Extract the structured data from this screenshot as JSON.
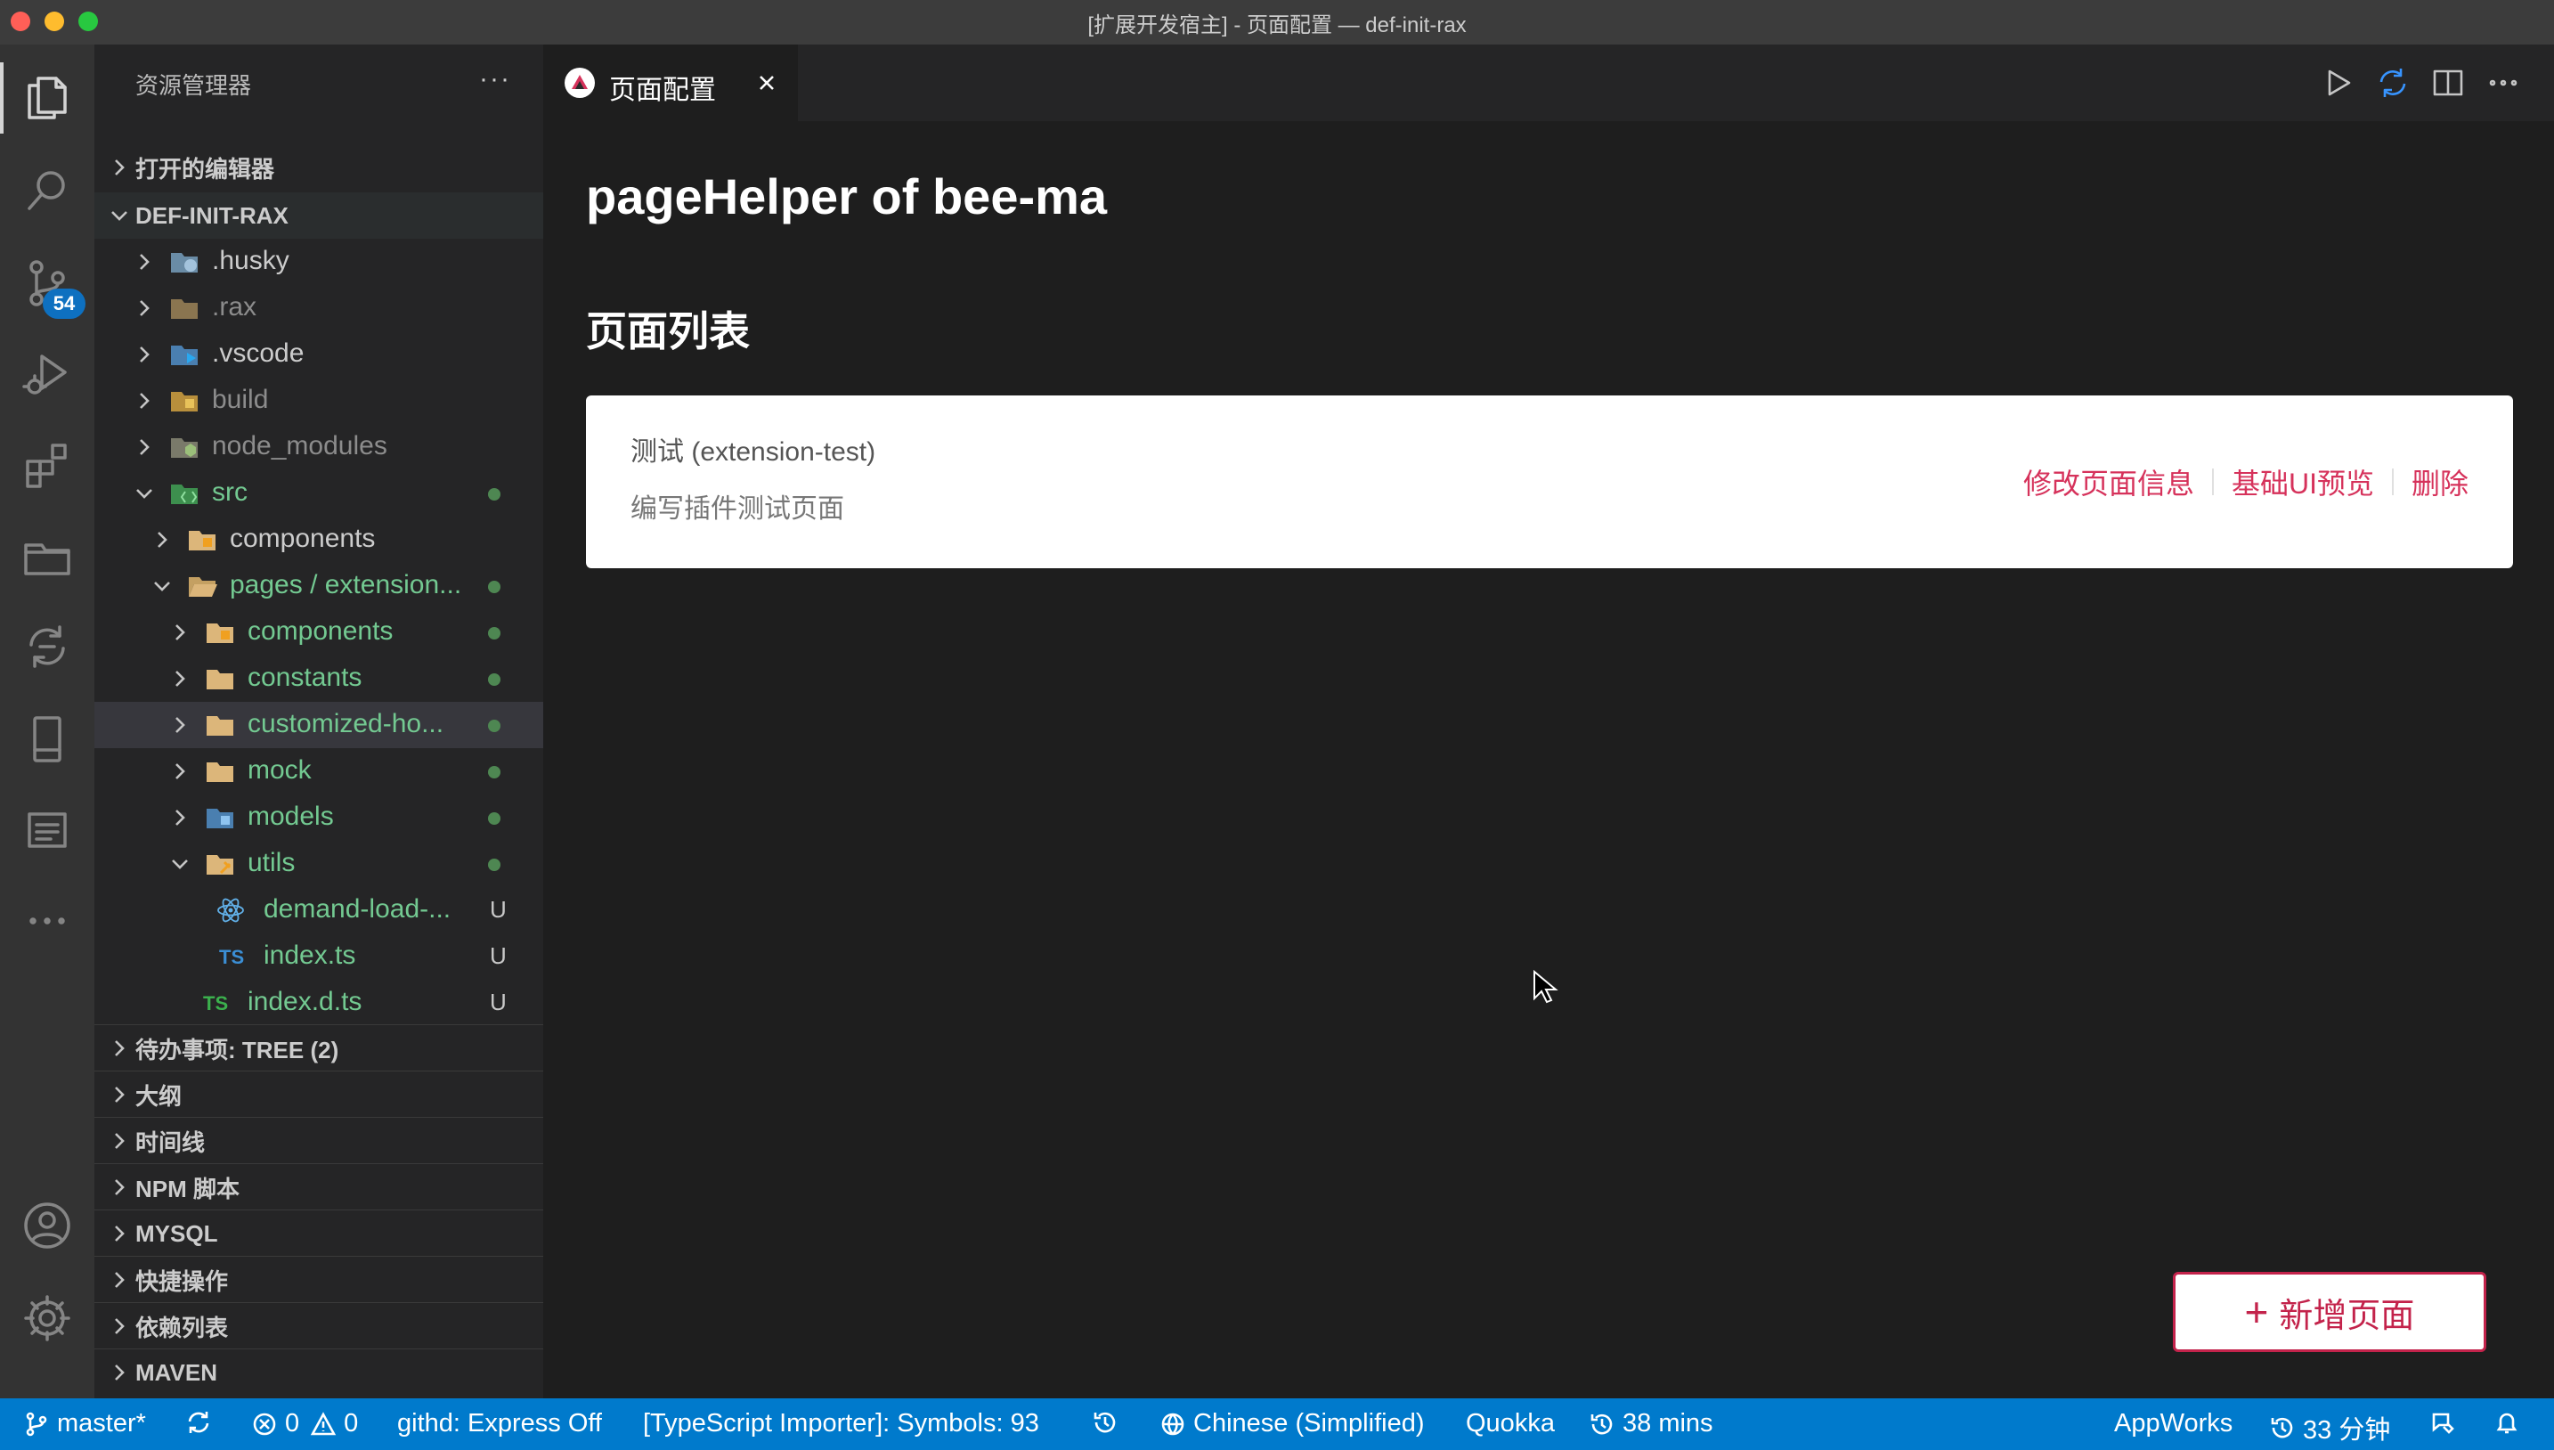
{
  "window": {
    "title": "[扩展开发宿主] - 页面配置 — def-init-rax"
  },
  "activity_bar": {
    "scm_badge": "54"
  },
  "sidebar": {
    "title": "资源管理器",
    "more": "···",
    "open_editors": "打开的编辑器",
    "project": "DEF-INIT-RAX",
    "tree": [
      {
        "name": ".husky",
        "status": ""
      },
      {
        "name": ".rax",
        "status": ""
      },
      {
        "name": ".vscode",
        "status": ""
      },
      {
        "name": "build",
        "status": ""
      },
      {
        "name": "node_modules",
        "status": ""
      },
      {
        "name": "src",
        "status": "dot"
      },
      {
        "name": "components",
        "status": ""
      },
      {
        "name": "pages / extension...",
        "status": "dot"
      },
      {
        "name": "components",
        "status": "dot"
      },
      {
        "name": "constants",
        "status": "dot"
      },
      {
        "name": "customized-ho...",
        "status": "dot"
      },
      {
        "name": "mock",
        "status": "dot"
      },
      {
        "name": "models",
        "status": "dot"
      },
      {
        "name": "utils",
        "status": "dot"
      },
      {
        "name": "demand-load-...",
        "status": "U"
      },
      {
        "name": "index.ts",
        "status": "U"
      },
      {
        "name": "index.d.ts",
        "status": "U"
      }
    ],
    "ts_label": "TS",
    "sections": [
      "待办事项: TREE (2)",
      "大纲",
      "时间线",
      "NPM 脚本",
      "MYSQL",
      "快捷操作",
      "依赖列表",
      "MAVEN"
    ]
  },
  "editor": {
    "tab_label": "页面配置",
    "heading": "pageHelper of bee-ma",
    "subheading": "页面列表",
    "card": {
      "title": "测试 (extension-test)",
      "desc": "编写插件测试页面",
      "actions": [
        "修改页面信息",
        "基础UI预览",
        "删除"
      ]
    },
    "add_button": "新增页面",
    "add_plus": "+"
  },
  "statusbar": {
    "branch": "master*",
    "errors": "0",
    "warnings": "0",
    "githd": "githd: Express Off",
    "ts_importer": "[TypeScript Importer]: Symbols: 93",
    "language": "Chinese (Simplified)",
    "quokka": "Quokka",
    "time1": "38 mins",
    "appworks": "AppWorks",
    "time2": "33 分钟"
  },
  "colors": {
    "accent": "#007acc",
    "brand_red": "#d6325b",
    "git_untracked": "#73c991",
    "folder": "#dcb67a"
  }
}
